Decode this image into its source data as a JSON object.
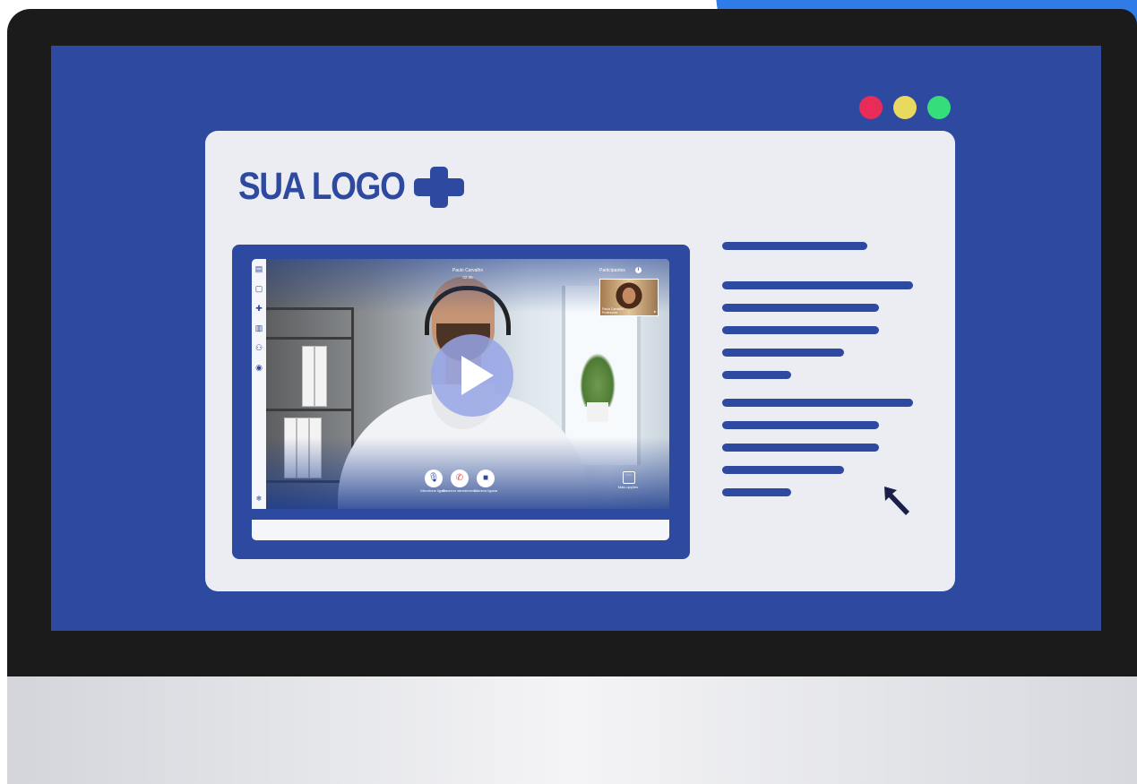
{
  "logo": {
    "text": "SUA LOGO",
    "icon": "medical-cross-icon"
  },
  "window_controls": [
    {
      "name": "close",
      "color": "#e82b57"
    },
    {
      "name": "minimize",
      "color": "#e9d95f"
    },
    {
      "name": "maximize",
      "color": "#35de7a"
    }
  ],
  "video_call": {
    "caller_name": "Paulo Carvalho",
    "call_time": "02:35",
    "participants_label": "Participantes",
    "participants_info_icon": "info-icon",
    "pip_name": "Paula Carvalho",
    "pip_role": "Professora",
    "play_icon": "play-icon",
    "controls": [
      {
        "icon": "microphone-icon",
        "label": "Microfone ligado"
      },
      {
        "icon": "phone-hangup-icon",
        "label": "Encerrar atendimento"
      },
      {
        "icon": "camera-icon",
        "label": "Câmera ligada"
      }
    ],
    "more_options_label": "Mais opções",
    "sidebar_icons": [
      "clipboard-icon",
      "chat-icon",
      "medical-plus-icon",
      "document-icon",
      "add-user-icon",
      "record-icon"
    ]
  },
  "colors": {
    "brand_blue": "#2e49a0",
    "accent_blue": "#2f7be8",
    "window_bg": "#ececf3",
    "bezel": "#1b1b1b"
  }
}
